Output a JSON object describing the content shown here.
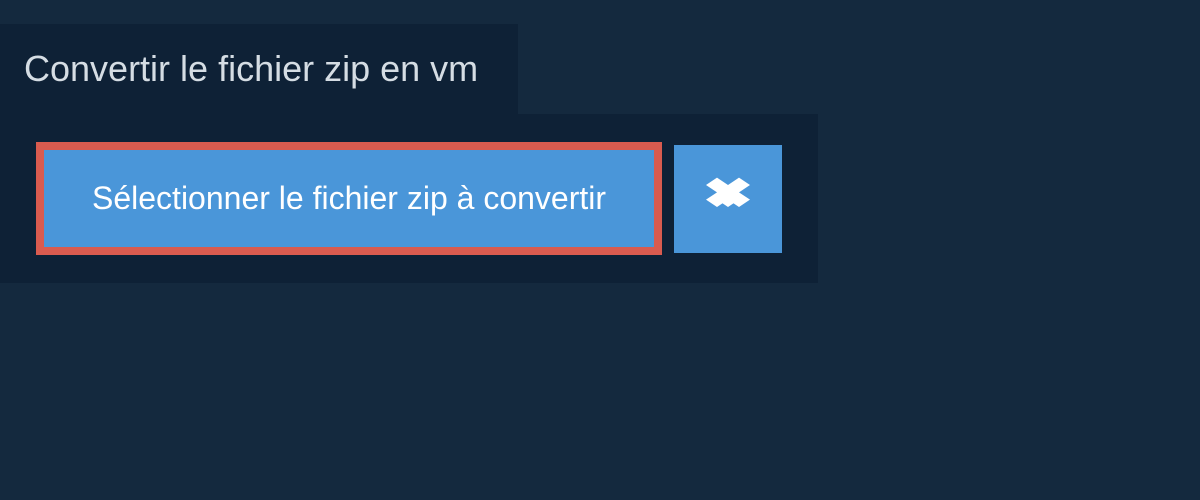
{
  "title": "Convertir le fichier zip en vm",
  "upload": {
    "select_label": "Sélectionner le fichier zip à convertir"
  },
  "colors": {
    "background": "#14293e",
    "panel": "#0e2136",
    "button": "#4a96d9",
    "highlight_border": "#d95b4f",
    "text_light": "#d5dde4",
    "text_white": "#ffffff"
  }
}
